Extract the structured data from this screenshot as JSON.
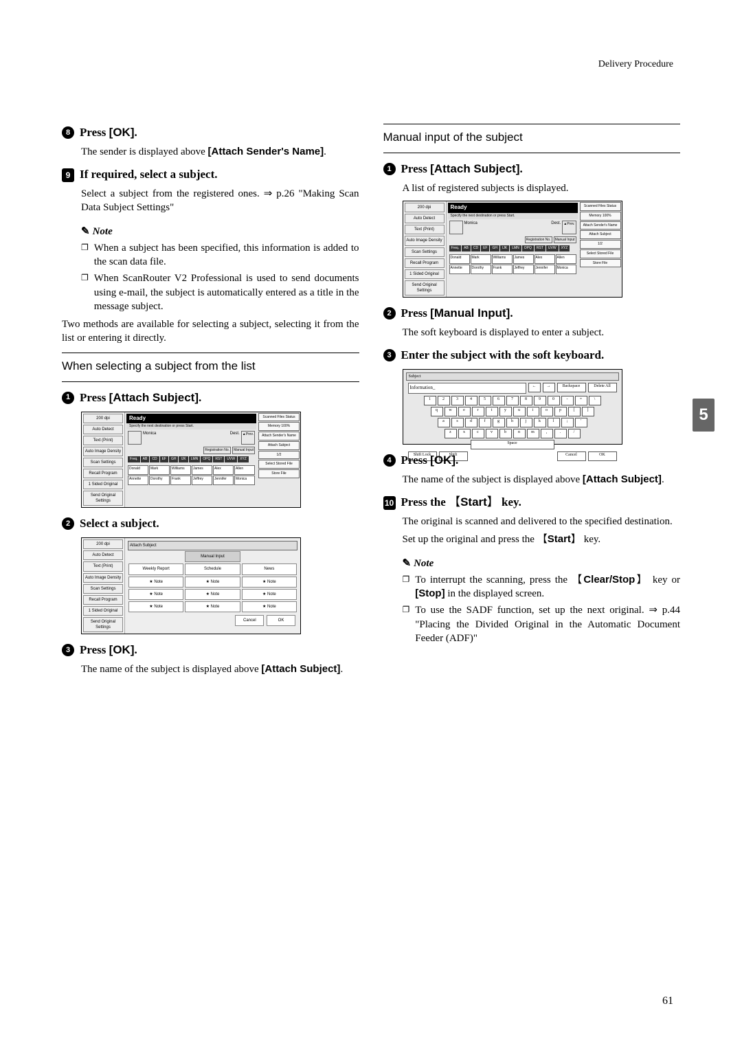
{
  "header": {
    "section": "Delivery Procedure"
  },
  "left": {
    "step8": {
      "num": "8",
      "title_a": "Press ",
      "title_b": "[OK]",
      "title_c": "."
    },
    "step8_body_a": "The sender is displayed above ",
    "step8_body_b": "[Attach Sender's Name]",
    "step8_body_c": ".",
    "step9": {
      "num": "9",
      "title": "If required, select a subject."
    },
    "step9_body": "Select a subject from the registered ones. ⇒ p.26 \"Making Scan Data Subject Settings\"",
    "note_label": "Note",
    "note1": "When a subject has been specified, this information is added to the scan data file.",
    "note2": "When ScanRouter V2 Professional is used to send documents using e-mail, the subject is automatically entered as a title in the message subject.",
    "tail": "Two methods are available for selecting a subject, selecting it from the list or entering it directly.",
    "sub1_title": "When selecting a subject from the list",
    "s1": {
      "num": "1",
      "a": "Press ",
      "b": "[Attach Subject]",
      "c": "."
    },
    "s2": {
      "num": "2",
      "title": "Select a subject."
    },
    "s3": {
      "num": "3",
      "a": "Press ",
      "b": "[OK]",
      "c": "."
    },
    "s3_body_a": "The name of the subject is displayed above ",
    "s3_body_b": "[Attach Subject]",
    "s3_body_c": "."
  },
  "right": {
    "sub2_title": "Manual input of the subject",
    "r1": {
      "num": "1",
      "a": "Press ",
      "b": "[Attach Subject]",
      "c": "."
    },
    "r1_body": "A list of registered subjects is displayed.",
    "r2": {
      "num": "2",
      "a": "Press ",
      "b": "[Manual Input]",
      "c": "."
    },
    "r2_body": "The soft keyboard is displayed to enter a subject.",
    "r3": {
      "num": "3",
      "title": "Enter the subject with the soft keyboard."
    },
    "r4": {
      "num": "4",
      "a": "Press ",
      "b": "[OK]",
      "c": "."
    },
    "r4_body_a": "The name of the subject is displayed above ",
    "r4_body_b": "[Attach Subject]",
    "r4_body_c": ".",
    "step10": {
      "num": "10",
      "a": "Press the ",
      "key": "Start",
      "c": " key."
    },
    "step10_body": "The original is scanned and delivered to the specified destination.",
    "step10_body2_a": "Set up the original and press the ",
    "step10_body2_key": "Start",
    "step10_body2_c": " key.",
    "note_label": "Note",
    "rnote1_a": "To interrupt the scanning, press the ",
    "rnote1_key": "Clear/Stop",
    "rnote1_b": " key or ",
    "rnote1_stop": "[Stop]",
    "rnote1_c": " in the displayed screen.",
    "rnote2": "To use the SADF function, set up the next original. ⇒ p.44 \"Placing the Divided Original in the Automatic Document Feeder (ADF)\""
  },
  "thumb": "5",
  "pagenum": "61",
  "ss": {
    "ready": "Ready",
    "bar": "Specify the next destination or press Start.",
    "left_btns": [
      "200 dpi",
      "Auto Detect",
      "Text (Print)",
      "Auto Image Density",
      "Scan Settings",
      "Recall Program",
      "1 Sided Original",
      "Send Original Settings"
    ],
    "right_btns": [
      "Scanned Files Status",
      "Memory 100%",
      "Attach Sender's Name",
      "Attach Subject",
      "Select Stored File",
      "Store File"
    ],
    "dest": "Dest.",
    "prev": "▲Prev.",
    "monica": "Monica",
    "reg": "Registration No.",
    "manual": "Manual Input",
    "tabs": [
      "Freq.",
      "AB",
      "CD",
      "EF",
      "GH",
      "IJK",
      "LMN",
      "OPQ",
      "RST",
      "UVW",
      "XYZ"
    ],
    "names": [
      "Donald",
      "Mark",
      "Williams",
      "James",
      "Alex",
      "Allen",
      "Annette",
      "Dorothy",
      "Frank",
      "Jeffrey",
      "Jennifer",
      "Monica"
    ],
    "pager": "1/2",
    "subj": {
      "title": "Attach Subject",
      "manual": "Manual Input",
      "heads": [
        "Weekly Report",
        "Schedule",
        "News"
      ],
      "star": "★ Note",
      "cancel": "Cancel",
      "ok": "OK"
    },
    "kb": {
      "subject": "Subject",
      "info": "Information_",
      "back": "Backspace",
      "del": "Delete All",
      "shift": "Shift Lock",
      "shift2": "Shift",
      "space": "Space",
      "cancel": "Cancel",
      "ok": "OK"
    }
  }
}
